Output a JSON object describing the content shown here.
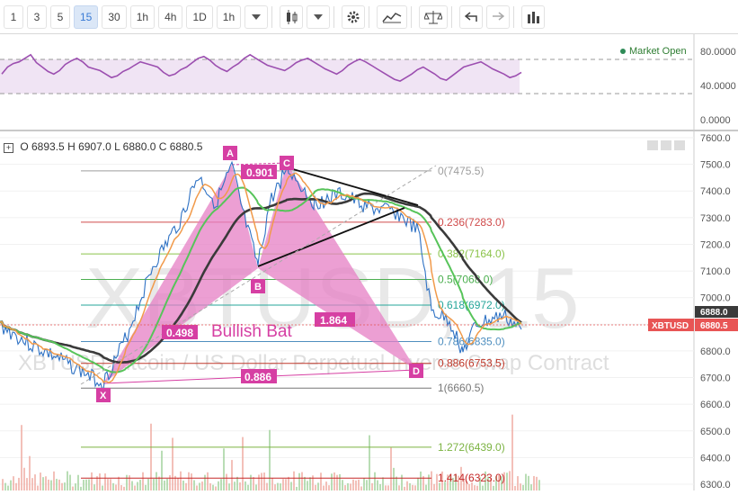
{
  "toolbar": {
    "intervals": [
      "1",
      "3",
      "5",
      "15",
      "30",
      "1h",
      "4h",
      "1D",
      "1h"
    ],
    "active_interval": "15"
  },
  "rsi": {
    "axis": [
      "80.0000",
      "40.0000",
      "0.0000"
    ],
    "market_status": "Market Open",
    "values": [
      52,
      60,
      64,
      66,
      70,
      74,
      65,
      60,
      55,
      52,
      56,
      63,
      67,
      70,
      66,
      60,
      58,
      56,
      52,
      48,
      50,
      55,
      58,
      62,
      66,
      64,
      62,
      60,
      54,
      50,
      52,
      57,
      60,
      65,
      70,
      72,
      68,
      62,
      58,
      55,
      60,
      64,
      70,
      74,
      70,
      66,
      62,
      60,
      58,
      56,
      60,
      65,
      68,
      70,
      66,
      62,
      58,
      55,
      52,
      56,
      62,
      66,
      69,
      66,
      62,
      58,
      54,
      50,
      46,
      44,
      48,
      52,
      57,
      60,
      56,
      52,
      47,
      45,
      50,
      55,
      60,
      62,
      64,
      66,
      62,
      58,
      55,
      52,
      48,
      50,
      54
    ]
  },
  "ohlc": {
    "o": "O 6893.5",
    "h": "H 6907.0",
    "l": "L 6880.0",
    "c": "C 6880.5"
  },
  "price_axis": [
    "7600.0",
    "7500.0",
    "7400.0",
    "7300.0",
    "7200.0",
    "7100.0",
    "7000.0",
    "6900.0",
    "6800.0",
    "6700.0",
    "6600.0",
    "6500.0",
    "6400.0",
    "6300.0"
  ],
  "watermark": {
    "symbol": "XBTUSD, 15",
    "desc": "XBTUSD Bitcoin / US Dollar Perpetual Inverse Swap Contract"
  },
  "fib_levels": [
    {
      "label": "0(7475.5)",
      "color": "#9e9e9e"
    },
    {
      "label": "0.236(7283.0)",
      "color": "#d04b4b"
    },
    {
      "label": "0.382(7164.0)",
      "color": "#8bc34a"
    },
    {
      "label": "0.5(7068.0)",
      "color": "#4caf50"
    },
    {
      "label": "0.618(6972.0)",
      "color": "#26a69a"
    },
    {
      "label": "0.786(6835.0)",
      "color": "#4f8fbf"
    },
    {
      "label": "0.886(6753.5)",
      "color": "#c0392b"
    },
    {
      "label": "1(6660.5)",
      "color": "#777777"
    },
    {
      "label": "1.272(6439.0)",
      "color": "#7cb342"
    },
    {
      "label": "1.414(6323.0)",
      "color": "#c62828"
    }
  ],
  "pattern": {
    "name": "Bullish Bat",
    "points": [
      "X",
      "A",
      "B",
      "C",
      "D"
    ],
    "ratios": [
      "0.901",
      "0.498",
      "1.864",
      "0.886"
    ]
  },
  "price_tags": {
    "upper": "6888.0",
    "symbol": "XBTUSD",
    "last": "6880.5"
  },
  "colors": {
    "pattern": "#e57fc4",
    "pattern_dark": "#d63fa3",
    "rsi": "#9c4fb0",
    "price_tag": "#e85555"
  }
}
